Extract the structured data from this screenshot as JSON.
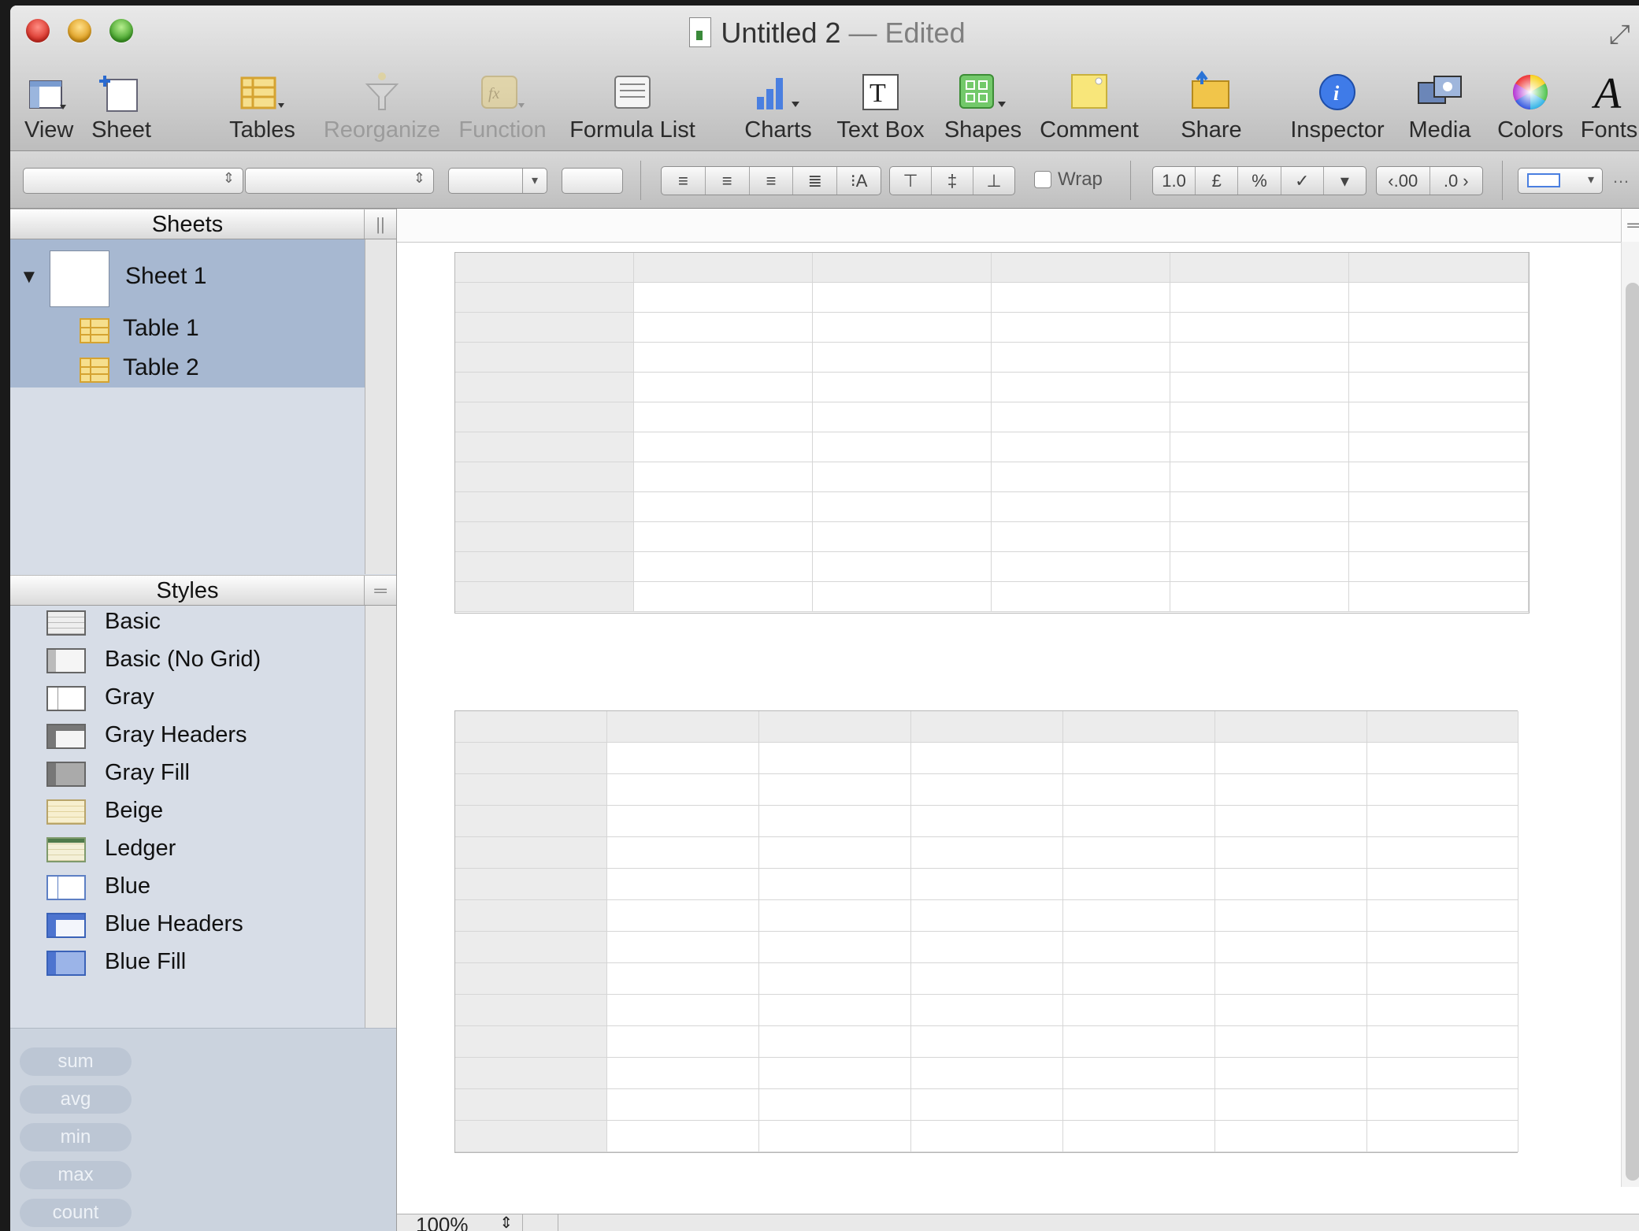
{
  "window": {
    "title": "Untitled 2",
    "edited_suffix": "— Edited"
  },
  "toolbar": {
    "items": [
      {
        "label": "View",
        "icon": "view-icon"
      },
      {
        "label": "Sheet",
        "icon": "sheet-icon"
      },
      {
        "label": "Tables",
        "icon": "tables-icon"
      },
      {
        "label": "Reorganize",
        "icon": "reorganize-icon",
        "disabled": true
      },
      {
        "label": "Function",
        "icon": "function-icon",
        "disabled": true
      },
      {
        "label": "Formula List",
        "icon": "formula-list-icon"
      },
      {
        "label": "Charts",
        "icon": "charts-icon"
      },
      {
        "label": "Text Box",
        "icon": "text-box-icon"
      },
      {
        "label": "Shapes",
        "icon": "shapes-icon"
      },
      {
        "label": "Comment",
        "icon": "comment-icon"
      },
      {
        "label": "Share",
        "icon": "share-icon"
      },
      {
        "label": "Inspector",
        "icon": "inspector-icon"
      },
      {
        "label": "Media",
        "icon": "media-icon"
      },
      {
        "label": "Colors",
        "icon": "colors-icon"
      },
      {
        "label": "Fonts",
        "icon": "fonts-icon"
      }
    ]
  },
  "format_bar": {
    "wrap_label": "Wrap",
    "number_buttons": [
      "1.0",
      "£",
      "%",
      "✓",
      "▾"
    ],
    "decimal_buttons": [
      "‹.00",
      ".0 ›"
    ]
  },
  "sheets_panel": {
    "title": "Sheets",
    "sheet_name": "Sheet 1",
    "tables": [
      "Table 1",
      "Table 2"
    ]
  },
  "styles_panel": {
    "title": "Styles",
    "styles": [
      "Basic",
      "Basic (No Grid)",
      "Gray",
      "Gray Headers",
      "Gray Fill",
      "Beige",
      "Ledger",
      "Blue",
      "Blue Headers",
      "Blue Fill"
    ]
  },
  "quick_calc": [
    "sum",
    "avg",
    "min",
    "max",
    "count"
  ],
  "zoom": {
    "value": "100%"
  },
  "colors": {
    "sidebar_bg": "#d7dde7",
    "selection": "#a7b8d1",
    "header_cell": "#ececec"
  }
}
